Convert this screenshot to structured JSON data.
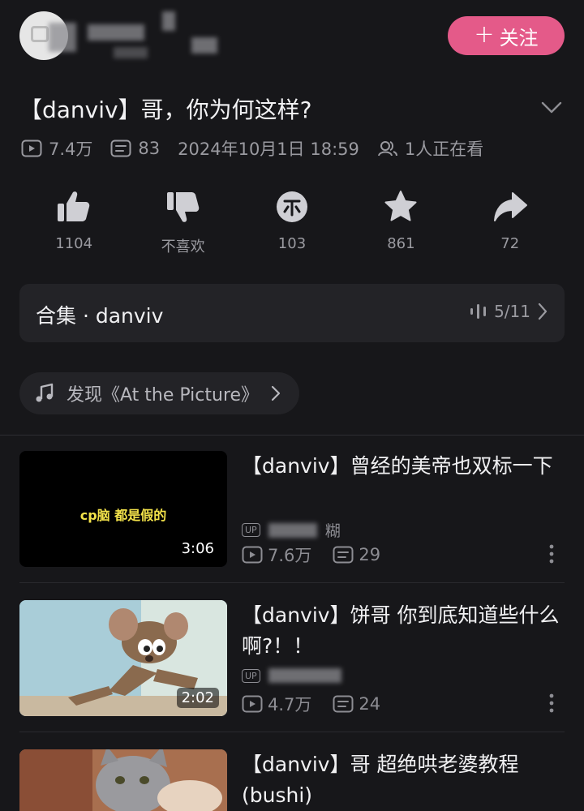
{
  "header": {
    "follow_label": "关注",
    "accent_color": "#e45a89"
  },
  "video": {
    "title": "【danviv】哥，你为何这样?",
    "views": "7.4万",
    "comments": "83",
    "published": "2024年10月1日 18:59",
    "watching": "1人正在看"
  },
  "actions": [
    {
      "icon": "thumbs-up-icon",
      "label": "1104"
    },
    {
      "icon": "thumbs-down-icon",
      "label": "不喜欢"
    },
    {
      "icon": "coin-icon",
      "label": "103"
    },
    {
      "icon": "star-icon",
      "label": "861"
    },
    {
      "icon": "share-icon",
      "label": "72"
    }
  ],
  "collection": {
    "label": "合集 · danviv",
    "progress": "5/11"
  },
  "music": {
    "label": "发现《At the Picture》"
  },
  "related": [
    {
      "title": "【danviv】曾经的美帝也双标一下",
      "thumb_caption": "cp脑 都是假的",
      "duration": "3:06",
      "up_name": "糊",
      "views": "7.6万",
      "comments": "29"
    },
    {
      "title": "【danviv】饼哥 你到底知道些什么啊?！！",
      "duration": "2:02",
      "views": "4.7万",
      "comments": "24"
    },
    {
      "title": "【danviv】哥 超绝哄老婆教程(bushi)"
    }
  ]
}
